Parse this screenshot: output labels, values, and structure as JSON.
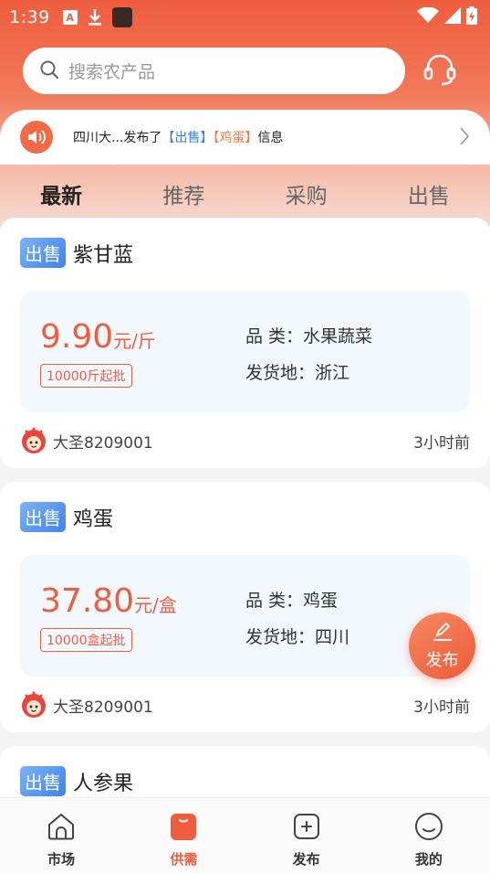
{
  "status_bar": {
    "time": "1:39",
    "notif_a": "A"
  },
  "search": {
    "placeholder": "搜索农产品"
  },
  "notice": {
    "prefix": "四川大...发布了",
    "tag_sale": "【出售】",
    "tag_egg": "【鸡蛋】",
    "suffix": "信息"
  },
  "tabs": [
    {
      "label": "最新",
      "active": true
    },
    {
      "label": "推荐",
      "active": false
    },
    {
      "label": "采购",
      "active": false
    },
    {
      "label": "出售",
      "active": false
    }
  ],
  "listings": [
    {
      "badge": "出售",
      "title": "紫甘蓝",
      "price": "9.90",
      "unit": "元/斤",
      "min_order": "10000斤起批",
      "category": "品 类：水果蔬菜",
      "origin": "发货地：浙江",
      "user": "大圣8209001",
      "time": "3小时前"
    },
    {
      "badge": "出售",
      "title": "鸡蛋",
      "price": "37.80",
      "unit": "元/盒",
      "min_order": "10000盒起批",
      "category": "品 类：鸡蛋",
      "origin": "发货地：四川",
      "user": "大圣8209001",
      "time": "3小时前"
    },
    {
      "badge": "出售",
      "title": "人参果"
    }
  ],
  "fab": {
    "label": "发布"
  },
  "bottom_nav": [
    {
      "label": "市场",
      "icon": "house-icon",
      "active": false
    },
    {
      "label": "供需",
      "icon": "supply-demand-icon",
      "active": true
    },
    {
      "label": "发布",
      "icon": "plus-square-icon",
      "active": false
    },
    {
      "label": "我的",
      "icon": "smile-face-icon",
      "active": false
    }
  ],
  "colors": {
    "accent": "#ef5d3e",
    "sale_blue": "#3f83ea",
    "egg_orange": "#f07a45"
  }
}
